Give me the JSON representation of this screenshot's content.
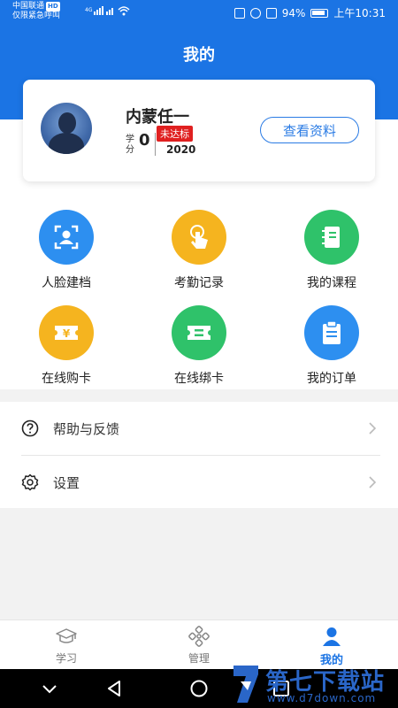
{
  "status_bar": {
    "carrier_line1": "中国联通",
    "carrier_badge": "HD",
    "carrier_line2": "仅限紧急呼叫",
    "network": "4G",
    "battery": "94%",
    "time": "上午10:31"
  },
  "header": {
    "title": "我的"
  },
  "profile": {
    "name": "内蒙任一",
    "credit_label": "学分",
    "credit_value": "0",
    "status_badge": "未达标",
    "year": "2020",
    "view_button": "查看资料"
  },
  "grid": [
    {
      "label": "人脸建档",
      "icon": "face-scan-icon",
      "color": "#2d8ff0"
    },
    {
      "label": "考勤记录",
      "icon": "touch-icon",
      "color": "#f5b41f"
    },
    {
      "label": "我的课程",
      "icon": "notebook-icon",
      "color": "#2fc26a"
    },
    {
      "label": "在线购卡",
      "icon": "yen-ticket-icon",
      "color": "#f5b41f"
    },
    {
      "label": "在线绑卡",
      "icon": "ticket-icon",
      "color": "#2fc26a"
    },
    {
      "label": "我的订单",
      "icon": "clipboard-icon",
      "color": "#2d8ff0"
    }
  ],
  "list": [
    {
      "label": "帮助与反馈",
      "icon": "help-icon"
    },
    {
      "label": "设置",
      "icon": "gear-icon"
    }
  ],
  "tabs": [
    {
      "label": "学习",
      "icon": "graduation-cap-icon",
      "active": false
    },
    {
      "label": "管理",
      "icon": "management-icon",
      "active": false
    },
    {
      "label": "我的",
      "icon": "person-icon",
      "active": true
    }
  ],
  "colors": {
    "primary": "#1b74e4",
    "badge": "#e02020"
  },
  "watermark": {
    "title": "第七下载站",
    "url": "www.d7down.com"
  }
}
